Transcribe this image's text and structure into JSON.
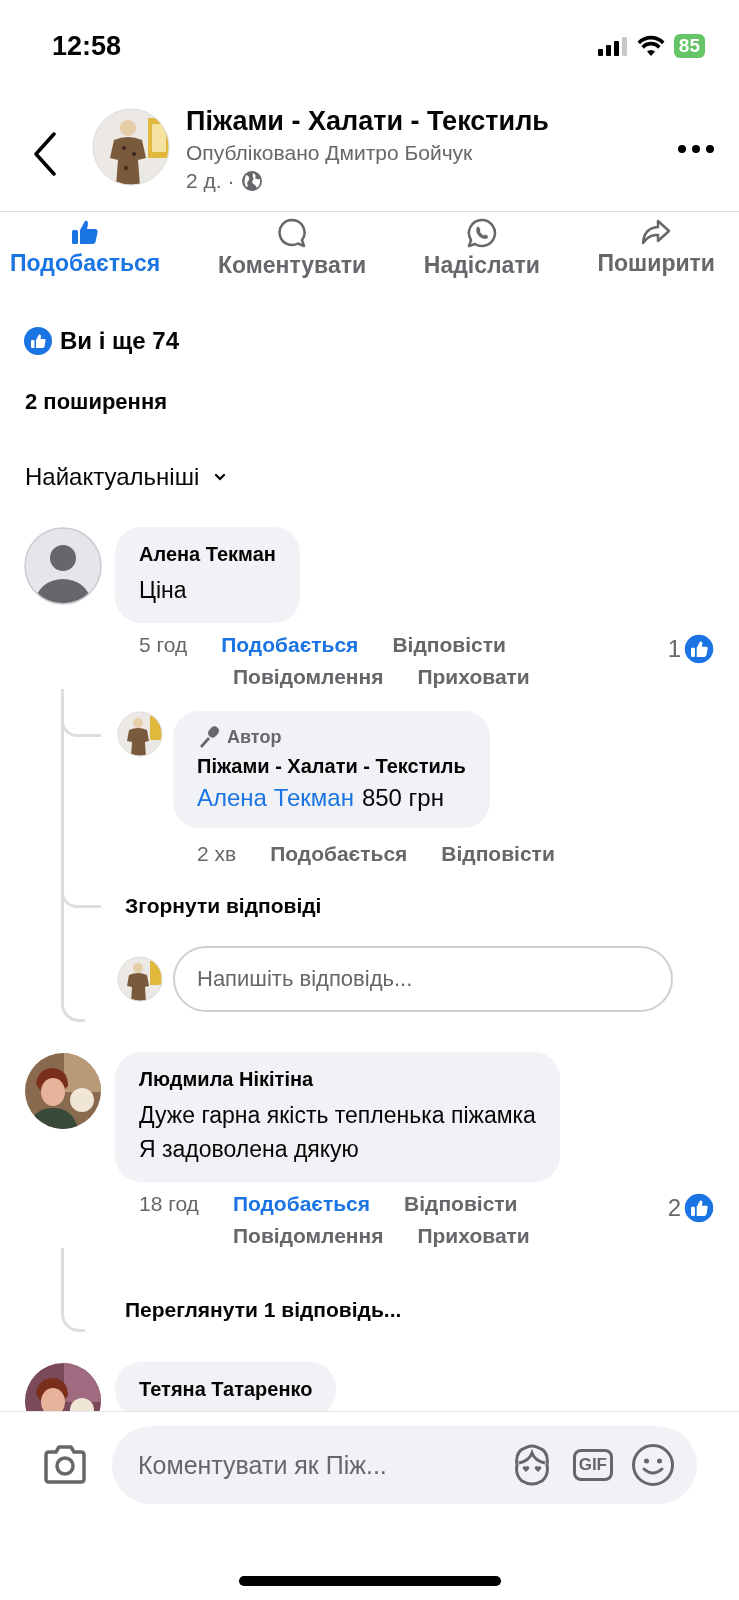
{
  "status_bar": {
    "time": "12:58",
    "battery": "85"
  },
  "header": {
    "title": "Піжами - Халати - Текстиль",
    "subtitle": "Опубліковано Дмитро Бойчук",
    "age": "2 д.",
    "separator": "·"
  },
  "actions": [
    {
      "label": "Подобається",
      "kind": "like",
      "selected": true
    },
    {
      "label": "Коментувати",
      "kind": "comment",
      "selected": false
    },
    {
      "label": "Надіслати",
      "kind": "whatsapp",
      "selected": false
    },
    {
      "label": "Поширити",
      "kind": "share",
      "selected": false
    }
  ],
  "reactions": {
    "text": "Ви і ще 74"
  },
  "shares": "2 поширення",
  "sort": {
    "label": "Найактуальніші"
  },
  "comments": [
    {
      "author": "Алена Текман",
      "kind": "silhouette",
      "text": "Ціна",
      "time": "5 год",
      "like_label": "Подобається",
      "liked": true,
      "reply_label": "Відповісти",
      "extra_actions": [
        "Повідомлення",
        "Приховати"
      ],
      "like_count": "1",
      "replies": [
        {
          "badge": "Автор",
          "author": "Піжами - Халати - Текстиль",
          "mention": "Алена Текман",
          "text": "850 грн",
          "time": "2 хв",
          "like_label": "Подобається",
          "liked": false,
          "reply_label": "Відповісти"
        }
      ],
      "collapse_label": "Згорнути відповіді",
      "reply_placeholder": "Напишіть відповідь..."
    },
    {
      "author": "Людмила Нікітіна",
      "kind": "picture",
      "text": "Дуже гарна якість тепленька піжамка\nЯ задоволена дякую",
      "time": "18 год",
      "like_label": "Подобається",
      "liked": true,
      "reply_label": "Відповісти",
      "extra_actions": [
        "Повідомлення",
        "Приховати"
      ],
      "like_count": "2",
      "view_replies_label": "Переглянути 1 відповідь..."
    },
    {
      "author": "Тетяна Татаренко",
      "kind": "picture"
    }
  ],
  "composer": {
    "placeholder": "Коментувати як Піж...",
    "gif_label": "GIF"
  }
}
